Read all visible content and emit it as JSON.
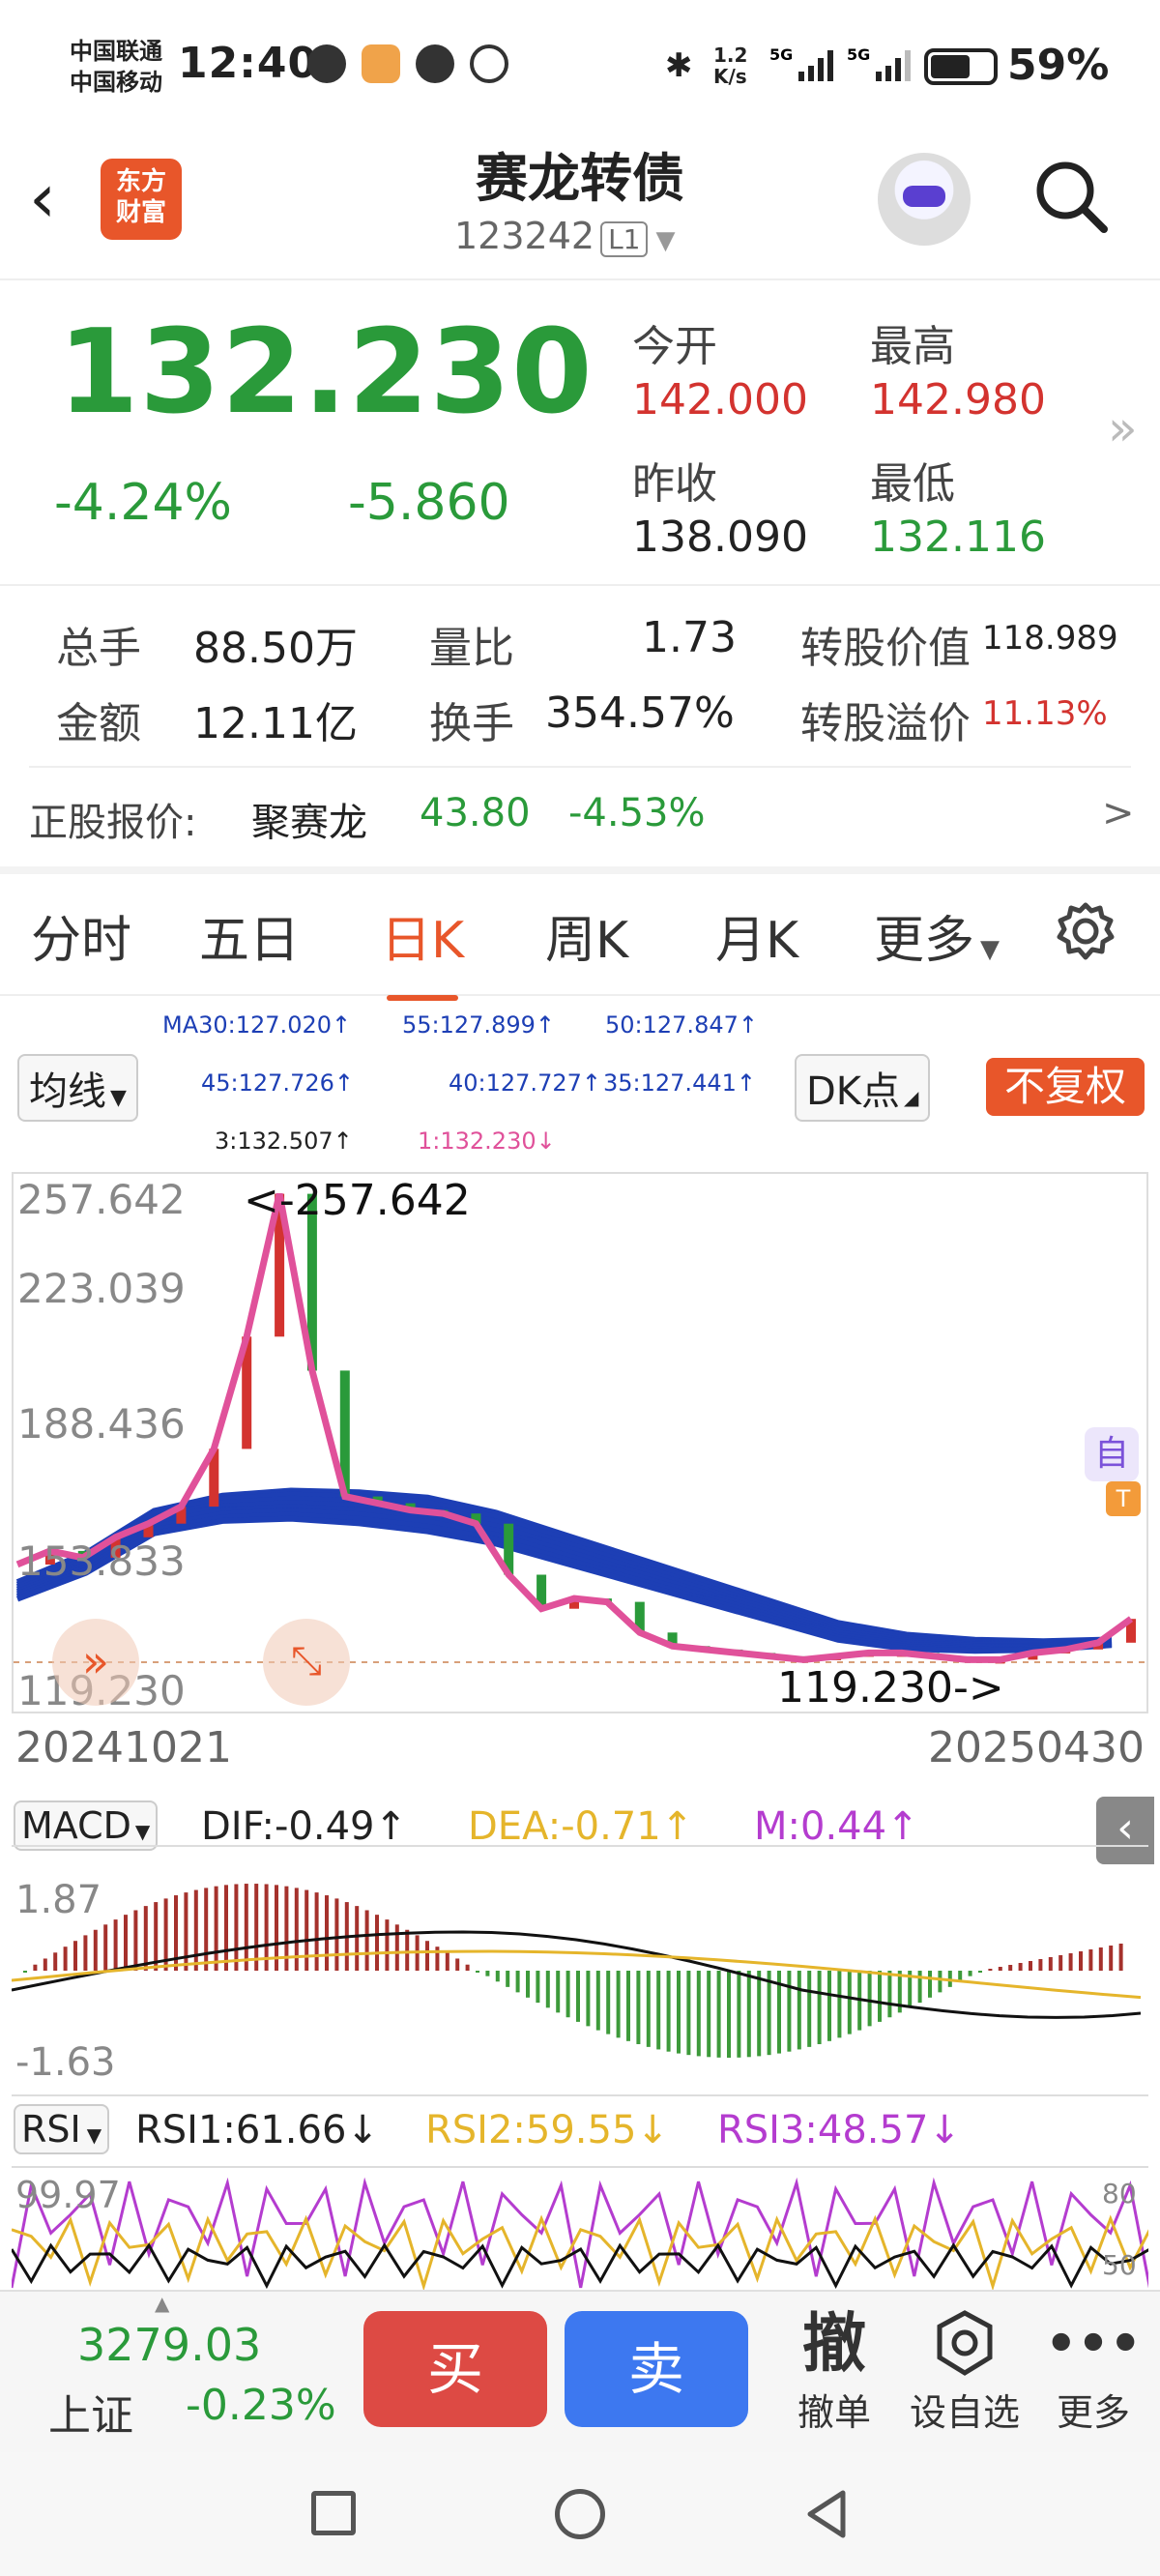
{
  "status_bar": {
    "carrier1": "中国联通",
    "carrier2": "中国移动",
    "time": "12:40",
    "net_speed": "1.2\nK/s",
    "battery": "59%"
  },
  "header": {
    "title": "赛龙转债",
    "code": "123242",
    "level": "L1",
    "logo_line1": "东方",
    "logo_line2": "财富"
  },
  "quote": {
    "price": "132.230",
    "change_pct": "-4.24%",
    "change": "-5.860",
    "open_label": "今开",
    "open": "142.000",
    "high_label": "最高",
    "high": "142.980",
    "prev_close_label": "昨收",
    "prev_close": "138.090",
    "low_label": "最低",
    "low": "132.116"
  },
  "stats": {
    "volume_label": "总手",
    "volume": "88.50万",
    "vol_ratio_label": "量比",
    "vol_ratio": "1.73",
    "conv_value_label": "转股价值",
    "conv_value": "118.989",
    "amount_label": "金额",
    "amount": "12.11亿",
    "turnover_label": "换手",
    "turnover": "354.57%",
    "premium_label": "转股溢价",
    "premium": "11.13%"
  },
  "underlying": {
    "label": "正股报价:",
    "name": "聚赛龙",
    "price": "43.80",
    "change": "-4.53%",
    "arrow": ">"
  },
  "tabs": [
    "分时",
    "五日",
    "日K",
    "周K",
    "月K",
    "更多"
  ],
  "active_tab": "日K",
  "ma": {
    "ma30": "MA30:127.020↑",
    "ma55": "55:127.899↑",
    "ma50": "50:127.847↑",
    "ma45": "45:127.726↑",
    "ma40": "40:127.727↑",
    "ma35": "35:127.441↑",
    "ma3": "3:132.507↑",
    "ma1": "1:132.230↓",
    "selector": "均线",
    "dk": "DK点",
    "adjust": "不复权"
  },
  "chart_data": {
    "type": "line",
    "title": "",
    "y_ticks": [
      "257.642",
      "223.039",
      "188.436",
      "153.833",
      "119.230"
    ],
    "x_range": [
      "20241021",
      "20250430"
    ],
    "max_label": "<-257.642",
    "min_label": "119.230->",
    "side_tags": [
      "自",
      "T"
    ],
    "series": [
      {
        "values": [
          148,
          152,
          150,
          156,
          160,
          165,
          182,
          215,
          257,
          205,
          168,
          166,
          164,
          163,
          160,
          145,
          135,
          138,
          137,
          128,
          124,
          123,
          122,
          121,
          120,
          121,
          122,
          122,
          121,
          120,
          120,
          122,
          123,
          125,
          132
        ]
      }
    ],
    "ma_band_values": [
      140,
      148,
      160,
      164,
      165,
      164,
      162,
      158,
      152,
      146,
      140,
      134,
      128,
      125,
      124,
      124,
      125
    ]
  },
  "macd": {
    "selector": "MACD",
    "dif": "DIF:-0.49↑",
    "dea": "DEA:-0.71↑",
    "m": "M:0.44↑",
    "ymax": "1.87",
    "ymin": "-1.63"
  },
  "rsi": {
    "selector": "RSI",
    "rsi1": "RSI1:61.66↓",
    "rsi2": "RSI2:59.55↓",
    "rsi3": "RSI3:48.57↓",
    "ytop": "99.97",
    "r80": "80",
    "r50": "50"
  },
  "bottom": {
    "index_value": "3279.03",
    "index_name": "上证",
    "index_change": "-0.23%",
    "buy": "买",
    "sell": "卖",
    "cancel_icon_text": "撤",
    "cancel": "撤单",
    "watch": "设自选",
    "more": "更多"
  },
  "colors": {
    "up": "#d3332f",
    "down": "#2a9a3a",
    "accent": "#e8562a",
    "ma_band": "#1d3fb5",
    "price_line": "#e0519a"
  }
}
